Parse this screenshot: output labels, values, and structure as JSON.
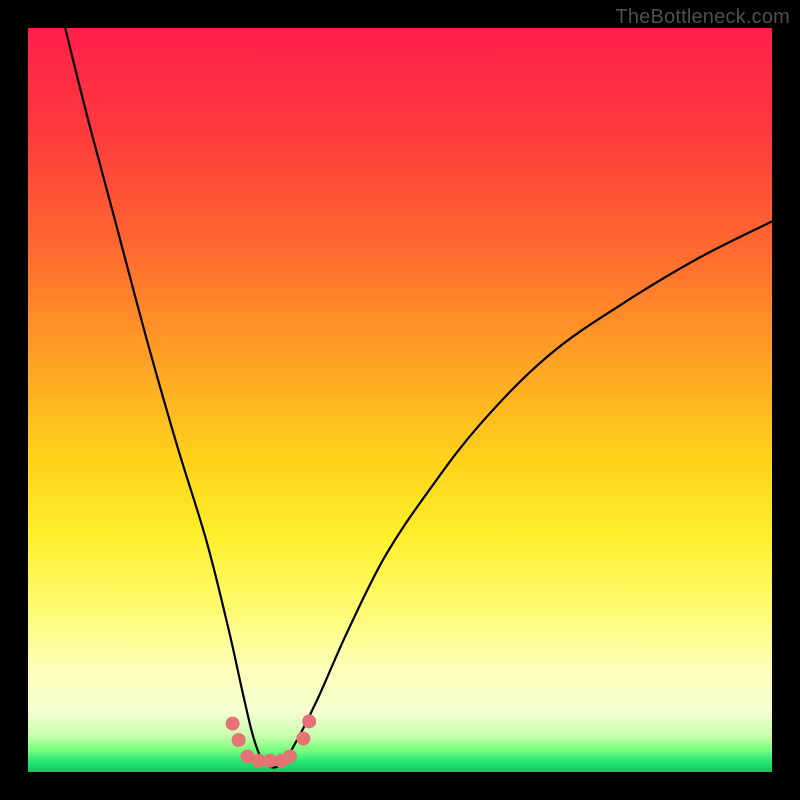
{
  "watermark": "TheBottleneck.com",
  "chart_data": {
    "type": "line",
    "title": "",
    "xlabel": "",
    "ylabel": "",
    "xlim": [
      0,
      100
    ],
    "ylim": [
      0,
      100
    ],
    "grid": false,
    "legend": false,
    "annotations": [],
    "series": [
      {
        "name": "bottleneck-curve",
        "color": "#000000",
        "x": [
          5,
          8,
          12,
          16,
          20,
          24,
          27,
          29,
          30.5,
          32,
          34,
          36,
          39,
          43,
          48,
          54,
          61,
          70,
          80,
          90,
          100
        ],
        "y": [
          100,
          88,
          73,
          58,
          44,
          31,
          19,
          10,
          4,
          1,
          1,
          4,
          10,
          19,
          29,
          38,
          47,
          56,
          63,
          69,
          74
        ]
      }
    ],
    "markers": {
      "name": "trough-dots",
      "color": "#e57373",
      "points": [
        {
          "x": 27.5,
          "y": 6.5
        },
        {
          "x": 28.3,
          "y": 4.3
        },
        {
          "x": 29.5,
          "y": 2.1
        },
        {
          "x": 31.0,
          "y": 1.5
        },
        {
          "x": 32.5,
          "y": 1.5
        },
        {
          "x": 34.0,
          "y": 1.5
        },
        {
          "x": 35.2,
          "y": 2.1
        },
        {
          "x": 37.0,
          "y": 4.5
        },
        {
          "x": 37.8,
          "y": 6.8
        }
      ]
    },
    "background_gradient": {
      "top": "#ff1f4a",
      "mid": "#ffd21a",
      "bottom": "#14c85e"
    }
  }
}
